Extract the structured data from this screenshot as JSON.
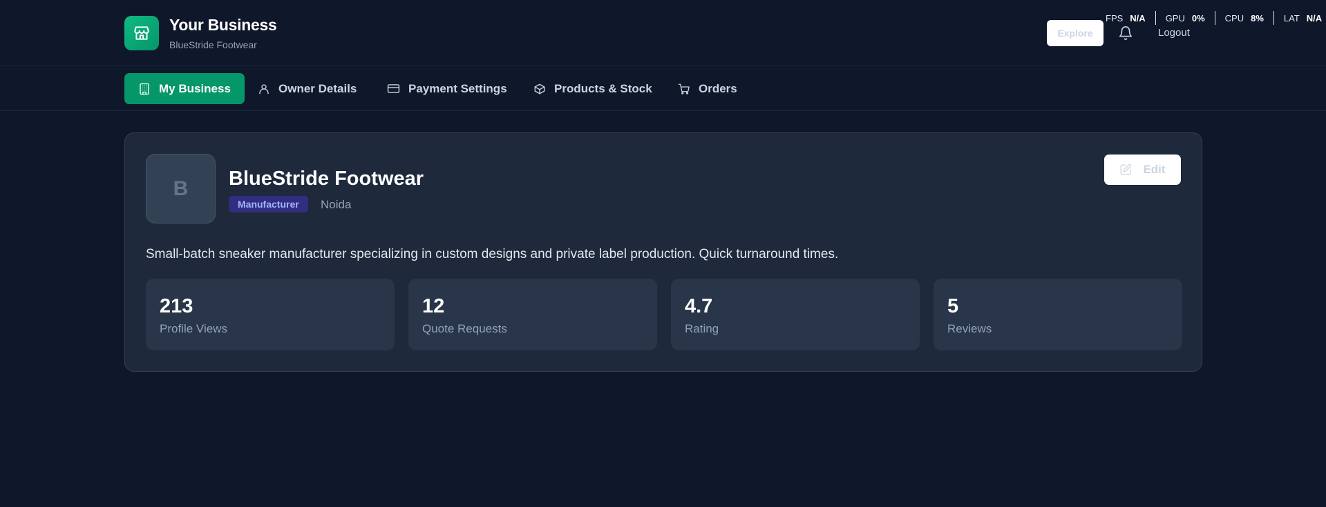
{
  "header": {
    "title": "Your Business",
    "subtitle": "BlueStride Footwear",
    "explore_label": "Explore",
    "logout_label": "Logout",
    "icons": {
      "logo": "store-icon",
      "notifications": "bell-icon"
    }
  },
  "metrics": [
    {
      "label": "FPS",
      "value": "N/A"
    },
    {
      "label": "GPU",
      "value": "0%"
    },
    {
      "label": "CPU",
      "value": "8%"
    },
    {
      "label": "LAT",
      "value": "N/A"
    }
  ],
  "nav": {
    "items": [
      {
        "label": "My Business",
        "icon": "building-icon",
        "active": true
      },
      {
        "label": "Owner Details",
        "icon": "user-icon",
        "active": false
      },
      {
        "label": "Payment Settings",
        "icon": "credit-card-icon",
        "active": false
      },
      {
        "label": "Products & Stock",
        "icon": "package-icon",
        "active": false
      },
      {
        "label": "Orders",
        "icon": "cart-icon",
        "active": false
      }
    ]
  },
  "business": {
    "avatar_letter": "B",
    "name": "BlueStride Footwear",
    "type": "Manufacturer",
    "city": "Noida",
    "edit_label": "Edit",
    "description": "Small-batch sneaker manufacturer specializing in custom designs and private label production. Quick turnaround times.",
    "stats": [
      {
        "value": "213",
        "label": "Profile Views"
      },
      {
        "value": "12",
        "label": "Quote Requests"
      },
      {
        "value": "4.7",
        "label": "Rating"
      },
      {
        "value": "5",
        "label": "Reviews"
      }
    ]
  },
  "colors": {
    "background": "#0f172a",
    "card": "#1e293b",
    "accent": "#059669",
    "tag_bg": "#312e81",
    "tag_text": "#a5b4fc"
  }
}
